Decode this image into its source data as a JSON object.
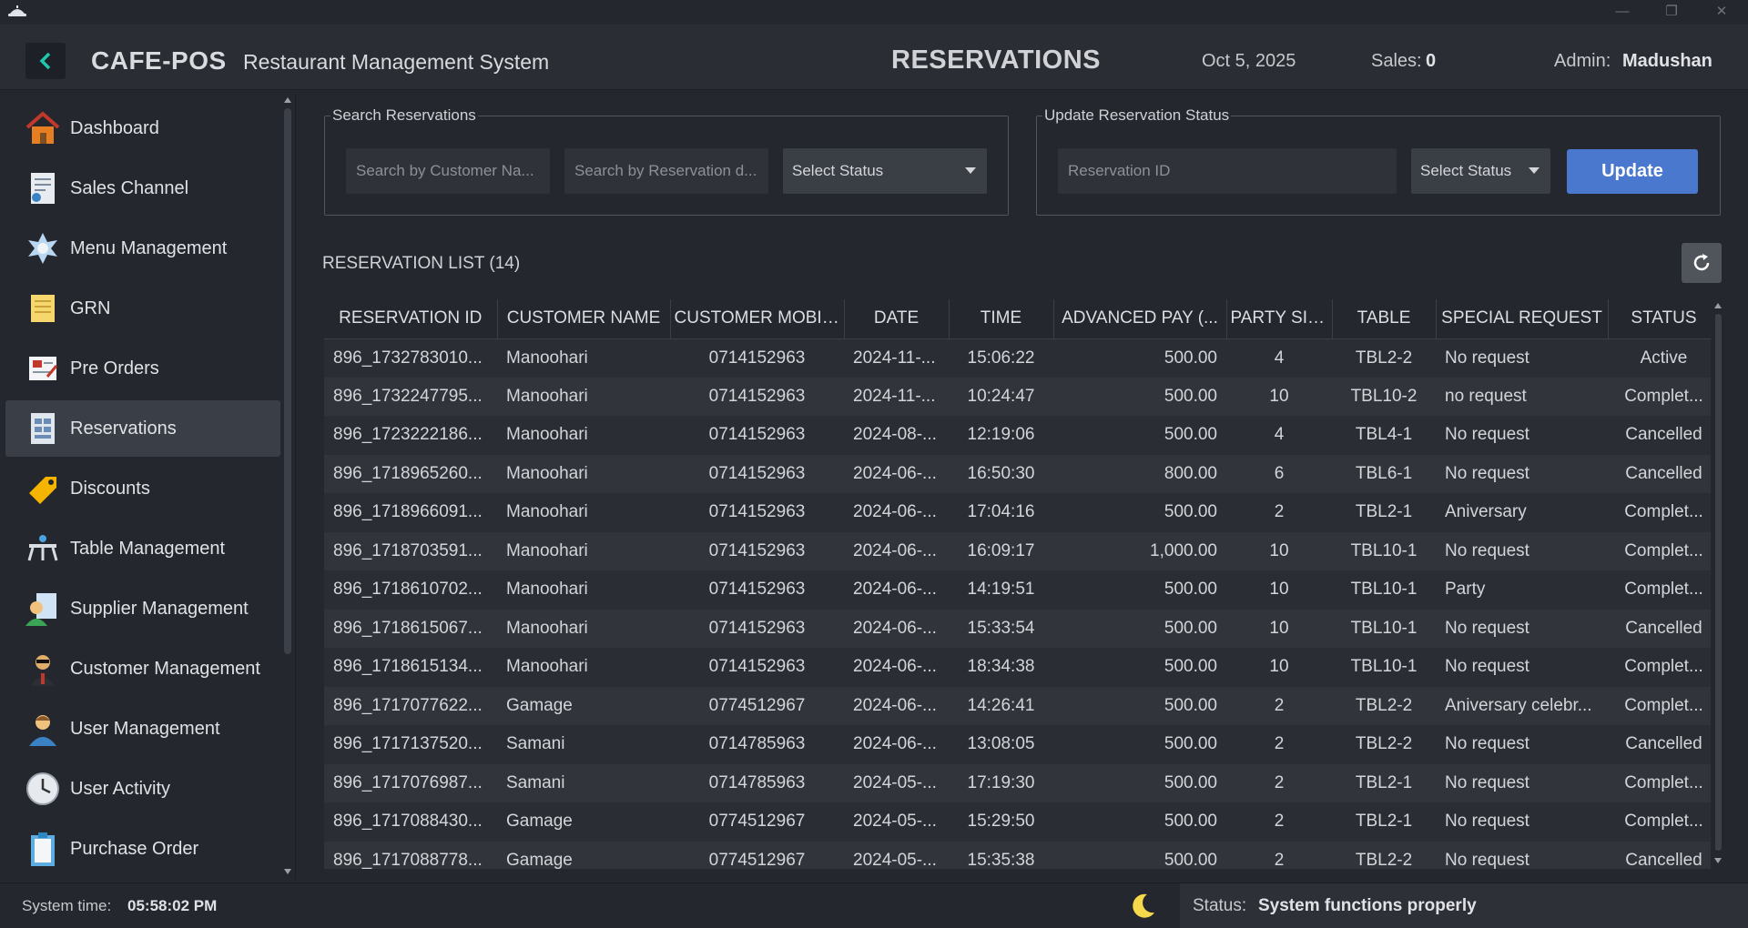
{
  "window": {
    "minimize": "—",
    "restore": "❐",
    "close": "✕"
  },
  "header": {
    "brand": "CAFE-POS",
    "subtitle": "Restaurant Management System",
    "page_title": "RESERVATIONS",
    "date": "Oct 5, 2025",
    "sales_label": "Sales:",
    "sales_value": "0",
    "admin_label": "Admin:",
    "admin_value": "Madushan"
  },
  "sidebar": {
    "items": [
      {
        "label": "Dashboard",
        "icon": "house-icon"
      },
      {
        "label": "Sales Channel",
        "icon": "receipt-icon"
      },
      {
        "label": "Menu Management",
        "icon": "menu-icon"
      },
      {
        "label": "GRN",
        "icon": "notepad-icon"
      },
      {
        "label": "Pre Orders",
        "icon": "preorder-icon"
      },
      {
        "label": "Reservations",
        "icon": "reservation-icon",
        "active": true
      },
      {
        "label": "Discounts",
        "icon": "tag-icon"
      },
      {
        "label": "Table Management",
        "icon": "table-icon"
      },
      {
        "label": "Supplier Management",
        "icon": "supplier-icon"
      },
      {
        "label": "Customer Management",
        "icon": "customer-icon"
      },
      {
        "label": "User Management",
        "icon": "user-icon"
      },
      {
        "label": "User Activity",
        "icon": "clock-icon"
      },
      {
        "label": "Purchase Order",
        "icon": "clipboard-icon"
      }
    ]
  },
  "search": {
    "title": "Search Reservations",
    "customer_placeholder": "Search by Customer Na...",
    "date_placeholder": "Search by Reservation d...",
    "status_select": "Select Status"
  },
  "update": {
    "title": "Update Reservation Status",
    "id_placeholder": "Reservation ID",
    "status_select": "Select Status",
    "button": "Update"
  },
  "list": {
    "title": "RESERVATION LIST (14)",
    "columns": [
      "RESERVATION ID",
      "CUSTOMER NAME",
      "CUSTOMER MOBILE",
      "DATE",
      "TIME",
      "ADVANCED PAY (...",
      "PARTY SIZE",
      "TABLE",
      "SPECIAL REQUEST",
      "STATUS"
    ],
    "rows": [
      [
        "896_1732783010...",
        "Manoohari",
        "0714152963",
        "2024-11-...",
        "15:06:22",
        "500.00",
        "4",
        "TBL2-2",
        "No request",
        "Active"
      ],
      [
        "896_1732247795...",
        "Manoohari",
        "0714152963",
        "2024-11-...",
        "10:24:47",
        "500.00",
        "10",
        "TBL10-2",
        "no request",
        "Complet..."
      ],
      [
        "896_1723222186...",
        "Manoohari",
        "0714152963",
        "2024-08-...",
        "12:19:06",
        "500.00",
        "4",
        "TBL4-1",
        "No request",
        "Cancelled"
      ],
      [
        "896_1718965260...",
        "Manoohari",
        "0714152963",
        "2024-06-...",
        "16:50:30",
        "800.00",
        "6",
        "TBL6-1",
        "No request",
        "Cancelled"
      ],
      [
        "896_1718966091...",
        "Manoohari",
        "0714152963",
        "2024-06-...",
        "17:04:16",
        "500.00",
        "2",
        "TBL2-1",
        "Aniversary",
        "Complet..."
      ],
      [
        "896_1718703591...",
        "Manoohari",
        "0714152963",
        "2024-06-...",
        "16:09:17",
        "1,000.00",
        "10",
        "TBL10-1",
        "No request",
        "Complet..."
      ],
      [
        "896_1718610702...",
        "Manoohari",
        "0714152963",
        "2024-06-...",
        "14:19:51",
        "500.00",
        "10",
        "TBL10-1",
        "Party",
        "Complet..."
      ],
      [
        "896_1718615067...",
        "Manoohari",
        "0714152963",
        "2024-06-...",
        "15:33:54",
        "500.00",
        "10",
        "TBL10-1",
        "No request",
        "Cancelled"
      ],
      [
        "896_1718615134...",
        "Manoohari",
        "0714152963",
        "2024-06-...",
        "18:34:38",
        "500.00",
        "10",
        "TBL10-1",
        "No request",
        "Complet..."
      ],
      [
        "896_1717077622...",
        "Gamage",
        "0774512967",
        "2024-06-...",
        "14:26:41",
        "500.00",
        "2",
        "TBL2-2",
        "Aniversary celebr...",
        "Complet..."
      ],
      [
        "896_1717137520...",
        "Samani",
        "0714785963",
        "2024-06-...",
        "13:08:05",
        "500.00",
        "2",
        "TBL2-2",
        "No request",
        "Cancelled"
      ],
      [
        "896_1717076987...",
        "Samani",
        "0714785963",
        "2024-05-...",
        "17:19:30",
        "500.00",
        "2",
        "TBL2-1",
        "No request",
        "Complet..."
      ],
      [
        "896_1717088430...",
        "Gamage",
        "0774512967",
        "2024-05-...",
        "15:29:50",
        "500.00",
        "2",
        "TBL2-1",
        "No request",
        "Complet..."
      ],
      [
        "896_1717088778...",
        "Gamage",
        "0774512967",
        "2024-05-...",
        "15:35:38",
        "500.00",
        "2",
        "TBL2-2",
        "No request",
        "Cancelled"
      ]
    ]
  },
  "statusbar": {
    "time_label": "System time:",
    "time_value": "05:58:02 PM",
    "status_label": "Status:",
    "status_value": "System functions properly"
  }
}
